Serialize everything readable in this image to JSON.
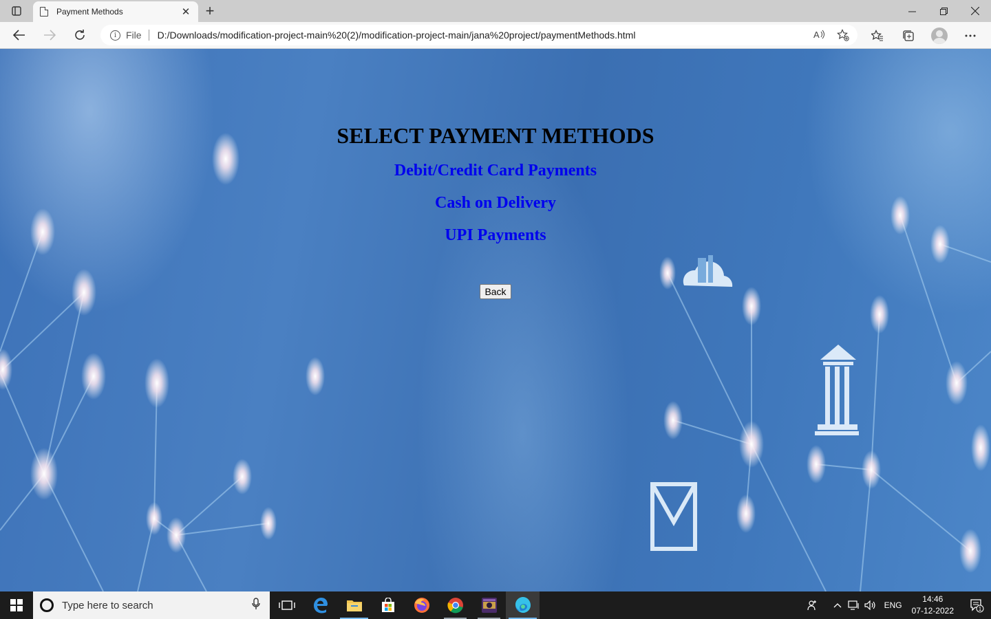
{
  "browser": {
    "tab_title": "Payment Methods",
    "scheme_label": "File",
    "url": "D:/Downloads/modification-project-main%20(2)/modification-project-main/jana%20project/paymentMethods.html"
  },
  "page": {
    "heading": "SELECT PAYMENT METHODS",
    "methods": [
      {
        "label": "Debit/Credit Card Payments"
      },
      {
        "label": "Cash on Delivery"
      },
      {
        "label": "UPI Payments"
      }
    ],
    "back_label": "Back"
  },
  "taskbar": {
    "search_placeholder": "Type here to search",
    "language": "ENG",
    "time": "14:46",
    "date": "07-12-2022",
    "notification_count": "1"
  },
  "colors": {
    "link": "#0000ee",
    "page_background": "#3d72b8",
    "taskbar": "#1c1c1c"
  }
}
